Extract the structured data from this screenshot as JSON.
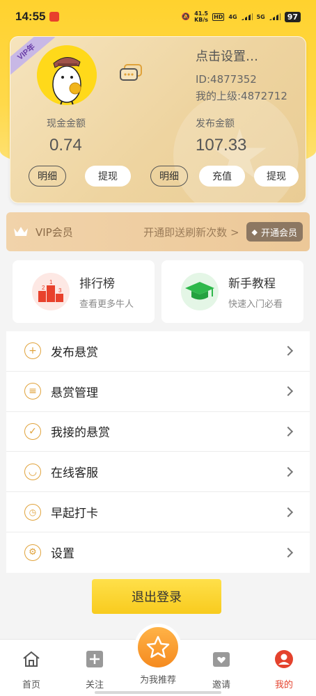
{
  "status": {
    "time": "14:55",
    "net_speed_top": "41.5",
    "net_speed_unit": "KB/s",
    "hd": "HD",
    "net1": "4G",
    "net2": "5G",
    "battery": "97"
  },
  "card": {
    "vip_badge": "VIP年",
    "title": "点击设置…",
    "id_line": "ID:4877352",
    "parent_line": "我的上级:4872712",
    "cash_label": "现金金额",
    "cash_amount": "0.74",
    "publish_label": "发布金额",
    "publish_amount": "107.33",
    "cash_detail_btn": "明细",
    "cash_withdraw_btn": "提现",
    "pub_detail_btn": "明细",
    "pub_recharge_btn": "充值",
    "pub_withdraw_btn": "提现"
  },
  "vip": {
    "label": "VIP会员",
    "promo": "开通即送刷新次数 >",
    "button": "开通会员"
  },
  "tiles": [
    {
      "title": "排行榜",
      "subtitle": "查看更多牛人"
    },
    {
      "title": "新手教程",
      "subtitle": "快速入门必看"
    }
  ],
  "menu": [
    {
      "label": "发布悬赏",
      "icon": "plus-circle-icon"
    },
    {
      "label": "悬赏管理",
      "icon": "list-circle-icon"
    },
    {
      "label": "我接的悬赏",
      "icon": "check-circle-icon"
    },
    {
      "label": "在线客服",
      "icon": "smile-circle-icon"
    },
    {
      "label": "早起打卡",
      "icon": "clock-circle-icon"
    },
    {
      "label": "设置",
      "icon": "gear-icon"
    }
  ],
  "logout": "退出登录",
  "tabs": [
    {
      "label": "首页"
    },
    {
      "label": "关注"
    },
    {
      "label": "为我推荐"
    },
    {
      "label": "邀请"
    },
    {
      "label": "我的"
    }
  ],
  "colors": {
    "accent_yellow": "#ffd22e",
    "active_tab": "#e4422d",
    "menu_icon": "#e0a23a"
  }
}
